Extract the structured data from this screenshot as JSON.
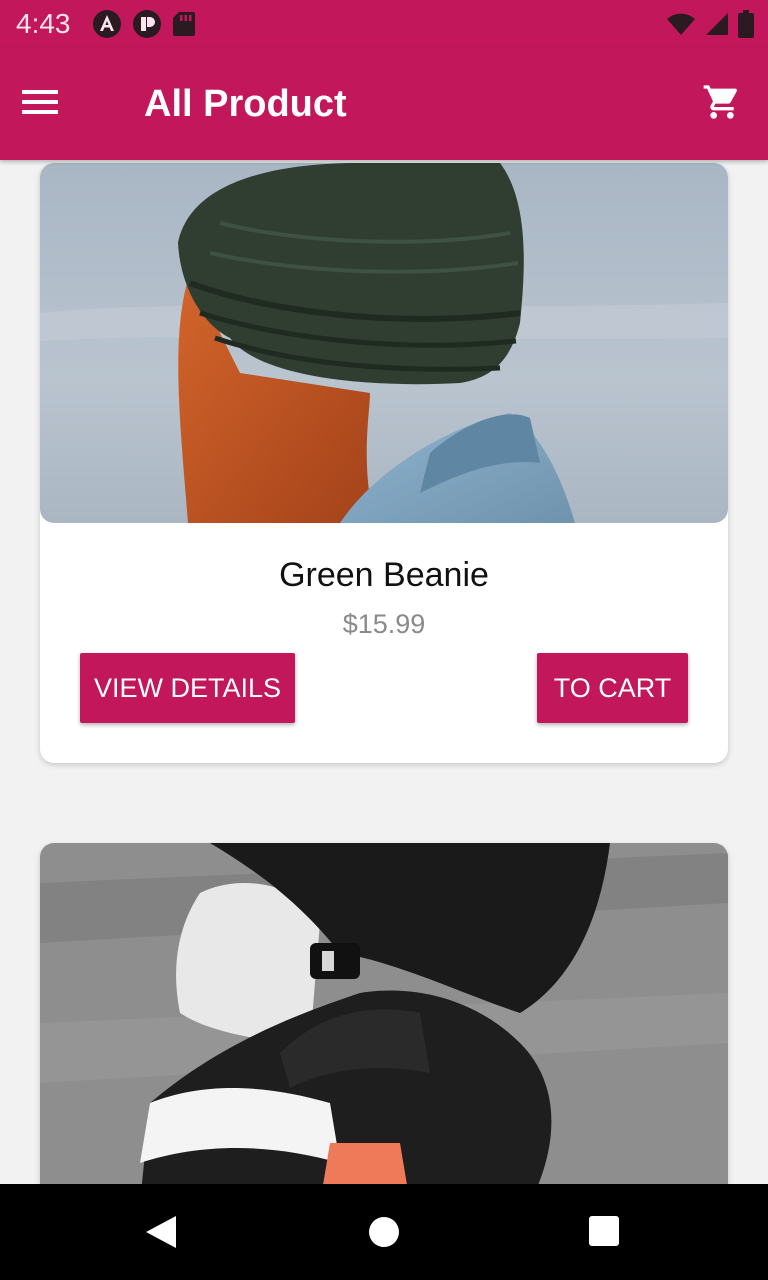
{
  "status_bar": {
    "time": "4:43",
    "left_icons": [
      "angular-icon",
      "record-icon",
      "sd-card-icon"
    ],
    "right_icons": [
      "wifi-icon",
      "signal-icon",
      "battery-icon"
    ]
  },
  "app_bar": {
    "title": "All Product",
    "menu_icon": "menu-icon",
    "cart_icon": "shopping-cart-icon",
    "color": "#c2185b"
  },
  "products": [
    {
      "name": "Green Beanie",
      "price": "$15.99",
      "view_details_label": "VIEW DETAILS",
      "to_cart_label": "TO CART"
    },
    {
      "name": "",
      "price": ""
    }
  ],
  "nav_bar": {
    "icons": [
      "back-icon",
      "home-icon",
      "recents-icon"
    ]
  }
}
